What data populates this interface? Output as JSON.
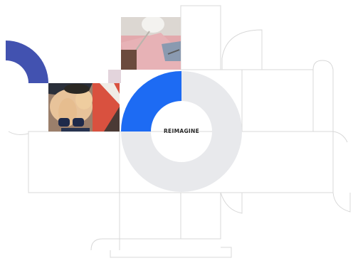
{
  "center_label": "REIMAGINE",
  "colors": {
    "accent_blue": "#1d6bf3",
    "indigo": "#4252b0",
    "ring_gray": "#e8e9ec",
    "line_gray": "#d8d8d8",
    "pink_small": "#e3d4dc"
  },
  "images": [
    {
      "name": "woman-in-bikini-photo"
    },
    {
      "name": "pink-desk-lamp-photo"
    }
  ]
}
